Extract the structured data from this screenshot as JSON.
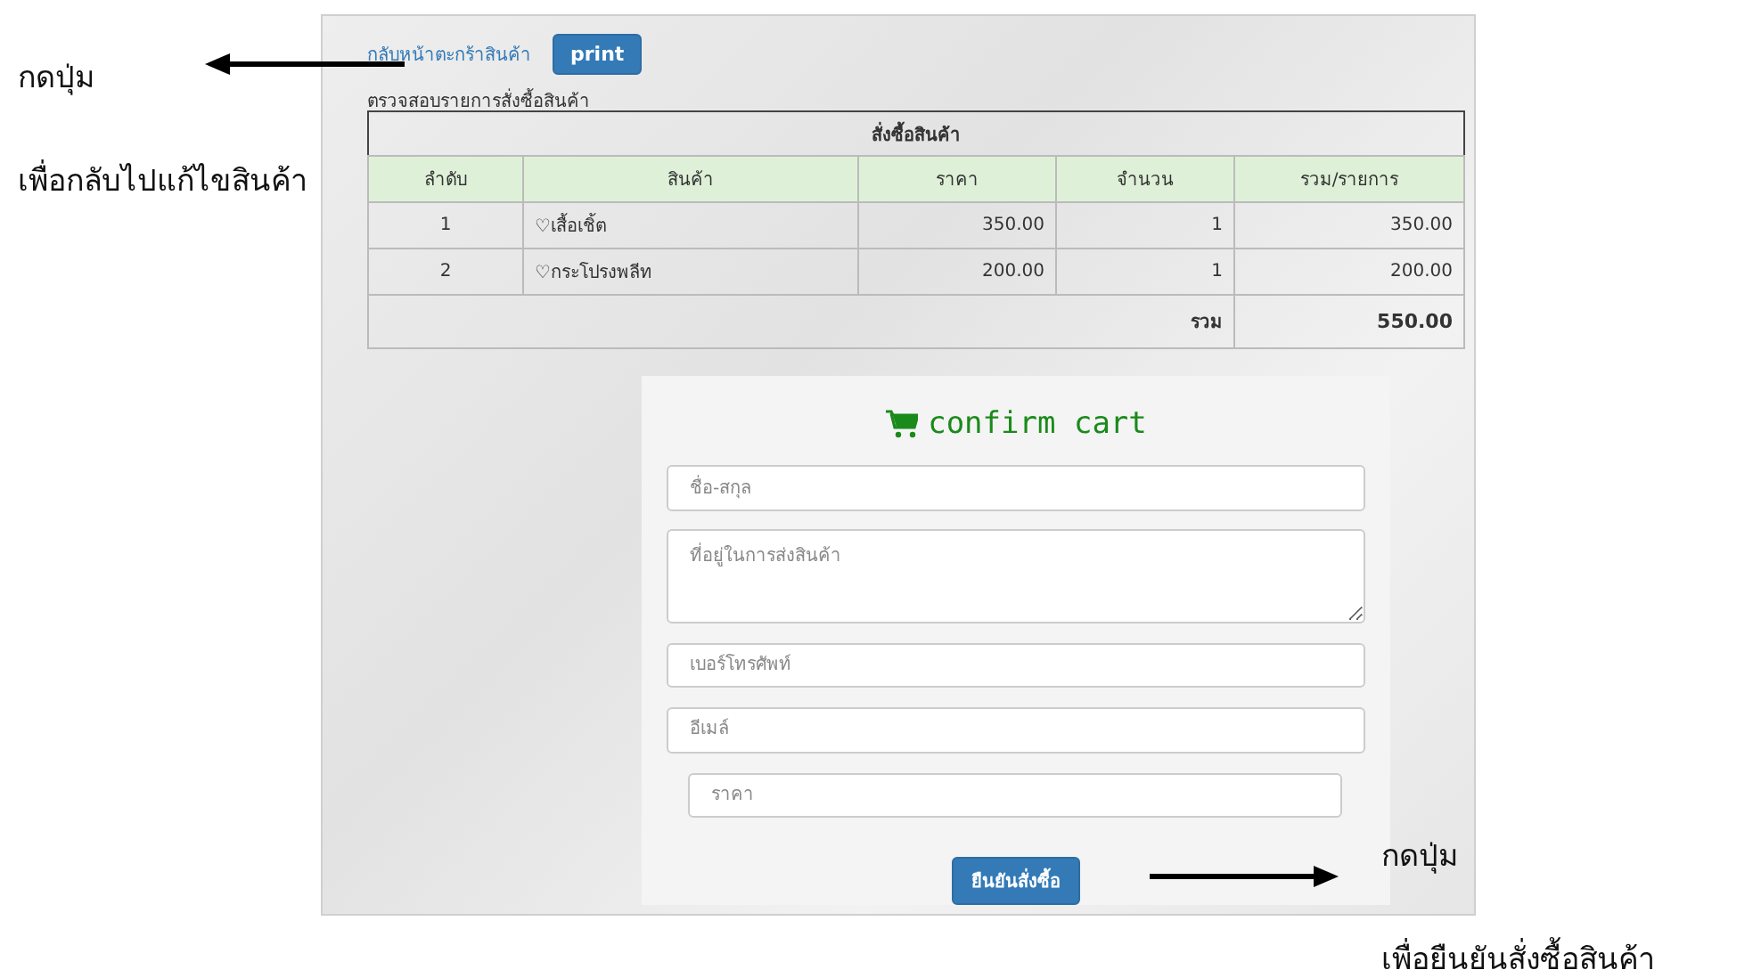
{
  "annotations": [
    {
      "lines": [
        "กดปุ่ม",
        "เพื่อกลับไปแก้ไขสินค้า"
      ],
      "kind": "left"
    },
    {
      "lines": [
        "กดปุ่ม",
        "เพื่อยืนยันสั่งซื้อสินค้า"
      ],
      "kind": "right"
    }
  ],
  "page": {
    "back_link": "กลับหน้าตะกร้าสินค้า",
    "print_button": "print",
    "section_title": "ตรวจสอบรายการสั่งซื้อสินค้า"
  },
  "table": {
    "caption": "สั่งซื้อสินค้า",
    "columns": [
      "ลำดับ",
      "สินค้า",
      "ราคา",
      "จำนวน",
      "รวม/รายการ"
    ],
    "rows": [
      {
        "no": "1",
        "item": "♡เสื้อเชิ้ต",
        "price": "350.00",
        "qty": "1",
        "subtotal": "350.00"
      },
      {
        "no": "2",
        "item": "♡กระโปรงพลีท",
        "price": "200.00",
        "qty": "1",
        "subtotal": "200.00"
      }
    ],
    "total_label": "รวม",
    "total_value": "550.00"
  },
  "form": {
    "title": "confirm cart",
    "fields": [
      {
        "kind": "text",
        "placeholder": "ชื่อ-สกุล"
      },
      {
        "kind": "textarea",
        "placeholder": "ที่อยู่ในการส่งสินค้า"
      },
      {
        "kind": "text",
        "placeholder": "เบอร์โทรศัพท์"
      },
      {
        "kind": "text",
        "placeholder": "อีเมล์"
      },
      {
        "kind": "inset",
        "placeholder": "ราคา"
      }
    ],
    "submit": "ยืนยันสั่งซื้อ"
  }
}
